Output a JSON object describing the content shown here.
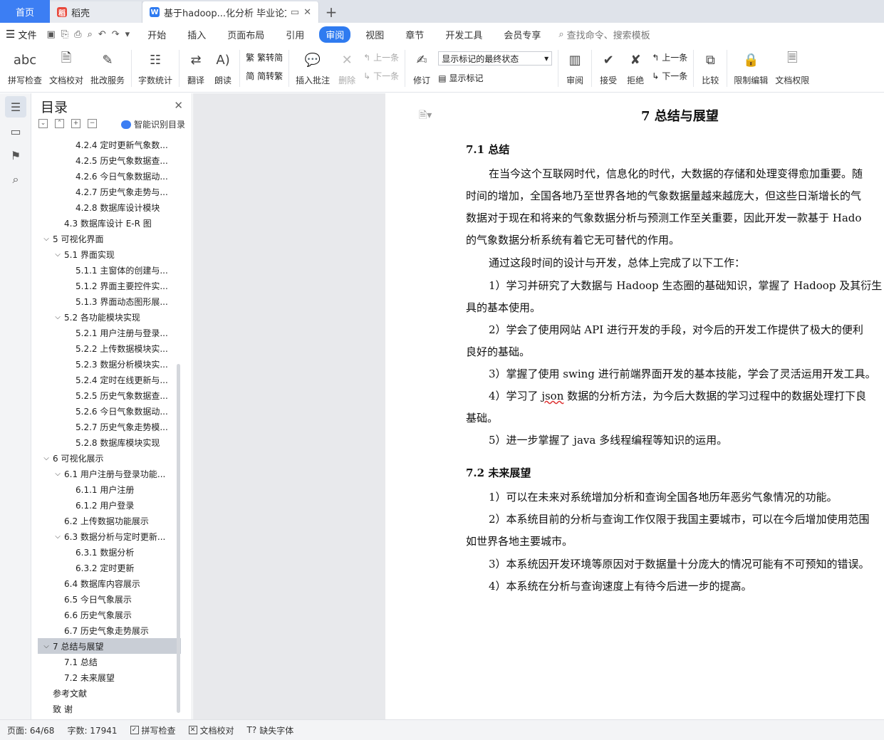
{
  "tabs": {
    "home": "首页",
    "docer": "稻壳",
    "active_doc": "基于hadoop...化分析 毕业论文"
  },
  "menu": {
    "file": "文件",
    "items": [
      "开始",
      "插入",
      "页面布局",
      "引用",
      "审阅",
      "视图",
      "章节",
      "开发工具",
      "会员专享"
    ],
    "active_index": 4,
    "search": "查找命令、搜索模板"
  },
  "ribbon": {
    "spell": "拼写检查",
    "doc_check": "文档校对",
    "revise_service": "批改服务",
    "word_count": "字数统计",
    "translate": "翻译",
    "read_aloud": "朗读",
    "to_traditional": "繁转简",
    "to_simplified": "简转繁",
    "insert_comment": "插入批注",
    "delete": "删除",
    "prev": "上一条",
    "next": "下一条",
    "revise": "修订",
    "markup_state": "显示标记的最终状态",
    "show_markup": "显示标记",
    "review": "审阅",
    "accept": "接受",
    "reject": "拒绝",
    "prev2": "上一条",
    "next2": "下一条",
    "compare": "比较",
    "restrict_edit": "限制编辑",
    "doc_permission": "文档权限"
  },
  "toc": {
    "title": "目录",
    "smart": "智能识别目录",
    "items": [
      {
        "level": 3,
        "label": "4.2.4 定时更新气象数..."
      },
      {
        "level": 3,
        "label": "4.2.5 历史气象数据查..."
      },
      {
        "level": 3,
        "label": "4.2.6 今日气象数据动..."
      },
      {
        "level": 3,
        "label": "4.2.7 历史气象走势与..."
      },
      {
        "level": 3,
        "label": "4.2.8 数据库设计模块"
      },
      {
        "level": 2,
        "label": "4.3 数据库设计 E-R 图"
      },
      {
        "level": 1,
        "label": "5 可视化界面",
        "expanded": true
      },
      {
        "level": 2,
        "label": "5.1 界面实现",
        "expanded": true
      },
      {
        "level": 3,
        "label": "5.1.1 主窗体的创建与..."
      },
      {
        "level": 3,
        "label": "5.1.2 界面主要控件实..."
      },
      {
        "level": 3,
        "label": "5.1.3 界面动态图形展..."
      },
      {
        "level": 2,
        "label": "5.2 各功能模块实现",
        "expanded": true
      },
      {
        "level": 3,
        "label": "5.2.1 用户注册与登录..."
      },
      {
        "level": 3,
        "label": "5.2.2 上传数据模块实..."
      },
      {
        "level": 3,
        "label": "5.2.3 数据分析模块实..."
      },
      {
        "level": 3,
        "label": "5.2.4 定时在线更新与..."
      },
      {
        "level": 3,
        "label": "5.2.5 历史气象数据查..."
      },
      {
        "level": 3,
        "label": "5.2.6 今日气象数据动..."
      },
      {
        "level": 3,
        "label": "5.2.7 历史气象走势模..."
      },
      {
        "level": 3,
        "label": "5.2.8 数据库模块实现"
      },
      {
        "level": 1,
        "label": "6 可视化展示",
        "expanded": true
      },
      {
        "level": 2,
        "label": "6.1 用户注册与登录功能...",
        "expanded": true
      },
      {
        "level": 3,
        "label": "6.1.1 用户注册"
      },
      {
        "level": 3,
        "label": "6.1.2 用户登录"
      },
      {
        "level": 2,
        "label": "6.2 上传数据功能展示"
      },
      {
        "level": 2,
        "label": "6.3 数据分析与定时更新...",
        "expanded": true
      },
      {
        "level": 3,
        "label": "6.3.1 数据分析"
      },
      {
        "level": 3,
        "label": "6.3.2 定时更新"
      },
      {
        "level": 2,
        "label": "6.4 数据库内容展示"
      },
      {
        "level": 2,
        "label": "6.5 今日气象展示"
      },
      {
        "level": 2,
        "label": "6.6 历史气象展示"
      },
      {
        "level": 2,
        "label": "6.7 历史气象走势展示"
      },
      {
        "level": 1,
        "label": "7 总结与展望",
        "expanded": true,
        "selected": true
      },
      {
        "level": 2,
        "label": "7.1 总结"
      },
      {
        "level": 2,
        "label": "7.2 未来展望"
      },
      {
        "level": 0,
        "label": "参考文献"
      },
      {
        "level": 0,
        "label": "致   谢"
      }
    ]
  },
  "doc": {
    "chapter_title": "7  总结与展望",
    "s1_title": "7.1 总结",
    "s1_lines": [
      "在当今这个互联网时代，信息化的时代，大数据的存储和处理变得愈加重要。随",
      "时间的增加，全国各地乃至世界各地的气象数据量越来越庞大，但这些日渐增长的气",
      "数据对于现在和将来的气象数据分析与预测工作至关重要，因此开发一款基于 Hado",
      "的气象数据分析系统有着它无可替代的作用。",
      "通过这段时间的设计与开发，总体上完成了以下工作：",
      "1）学习并研究了大数据与 Hadoop 生态圈的基础知识，掌握了 Hadoop 及其衍生",
      "具的基本使用。",
      "2）学会了使用网站 API 进行开发的手段，对今后的开发工作提供了极大的便利",
      "良好的基础。",
      "3）掌握了使用 swing 进行前端界面开发的基本技能，学会了灵活运用开发工具。",
      "4）学习了 json 数据的分析方法，为今后大数据的学习过程中的数据处理打下良",
      "基础。",
      "5）进一步掌握了 java 多线程编程等知识的运用。"
    ],
    "s2_title": "7.2 未来展望",
    "s2_lines": [
      "1）可以在未来对系统增加分析和查询全国各地历年恶劣气象情况的功能。",
      "2）本系统目前的分析与查询工作仅限于我国主要城市，可以在今后增加使用范围",
      "如世界各地主要城市。",
      "3）本系统因开发环境等原因对于数据量十分庞大的情况可能有不可预知的错误。",
      "4）本系统在分析与查询速度上有待今后进一步的提高。"
    ]
  },
  "status": {
    "page": "页面: 64/68",
    "words": "字数: 17941",
    "spell": "拼写检查",
    "proof": "文档校对",
    "missing_font": "缺失字体"
  }
}
